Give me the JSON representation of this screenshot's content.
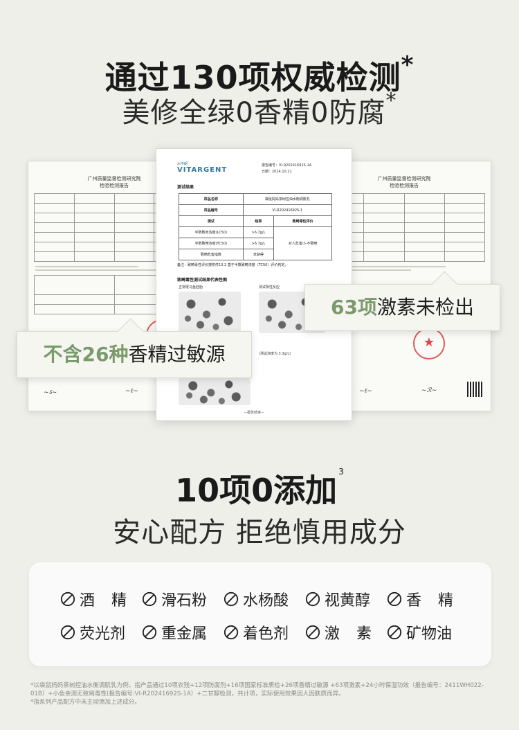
{
  "header": {
    "title": "通过130项权威检测",
    "title_mark": "*",
    "subtitle": "美修全绿0香精0防腐",
    "subtitle_mark": "*"
  },
  "docs": {
    "left": {
      "org_line1": "广州质量监督检测研究院",
      "org_line2": "检验检测报告"
    },
    "center": {
      "brand": "VITARGENT",
      "brand_cn": "水中朗",
      "report_no_label": "报告编号：VI-R20241692S-1A",
      "report_date": "日期：2024.10.21",
      "section_result": "测试结果",
      "table": {
        "rows": [
          [
            "样品名称",
            "袋鼠妈妈茶树控油水衡调肌乳"
          ],
          [
            "样品编号",
            "VI-R20241692S-1"
          ],
          [
            "测试",
            "结果",
            "致畸毒性评价"
          ],
          [
            "半数致死浓度(LC50)",
            ">6.7g/L",
            "对人危害小·不致畸"
          ],
          [
            "半数致畸浓度(TC50)",
            ">6.7g/L",
            ""
          ],
          [
            "致畸危害指数",
            "未获得",
            ""
          ]
        ]
      },
      "note": "备注：致畸毒性评价按附件13.2 基于半数致畸浓度（TC50）评价判定。",
      "section_images": "致畸毒性测试结果代表性图",
      "img_label_1": "正常斑马鱼胚胎",
      "img_label_2": "测试阳性反应",
      "img_label_3": "(测试浓度为 3.3g/L)",
      "end_mark": "—报告结束—"
    },
    "right": {
      "org_line1": "广州质量监督检测研究院",
      "org_line2": "检验检测报告"
    }
  },
  "callouts": {
    "left_accent": "不含26种",
    "left_text": "香精过敏源",
    "right_accent": "63项",
    "right_text": "激素未检出"
  },
  "section2": {
    "title": "10项0添加",
    "title_mark": "3",
    "subtitle": "安心配方 拒绝慎用成分"
  },
  "free_from": [
    {
      "label": "酒精",
      "spread": true
    },
    {
      "label": "滑石粉",
      "spread": false
    },
    {
      "label": "水杨酸",
      "spread": false
    },
    {
      "label": "视黄醇",
      "spread": false
    },
    {
      "label": "香精",
      "spread": true
    },
    {
      "label": "荧光剂",
      "spread": false
    },
    {
      "label": "重金属",
      "spread": false
    },
    {
      "label": "着色剂",
      "spread": false
    },
    {
      "label": "激素",
      "spread": true
    },
    {
      "label": "矿物油",
      "spread": false
    }
  ],
  "footnotes": [
    "*以袋鼠妈妈茶树控油水衡调肌乳为例，指产品通过10项农残+12项防腐剂+16项国家标准质检+26项香精过敏源 +63项激素+24小时保湿功效（报告编号：2411WH022-01B）+小鱼亲测无致畸毒性(报告编号:VI-R20241692S-1A）+二甘醇检测，共计项，实际使用效果因人因肤质而异。",
    "*指系列产品配方中未主动添加上述成分。"
  ],
  "colors": {
    "background": "#efefea",
    "accent_green": "#7a9a6c",
    "stamp_red": "#d22828"
  }
}
